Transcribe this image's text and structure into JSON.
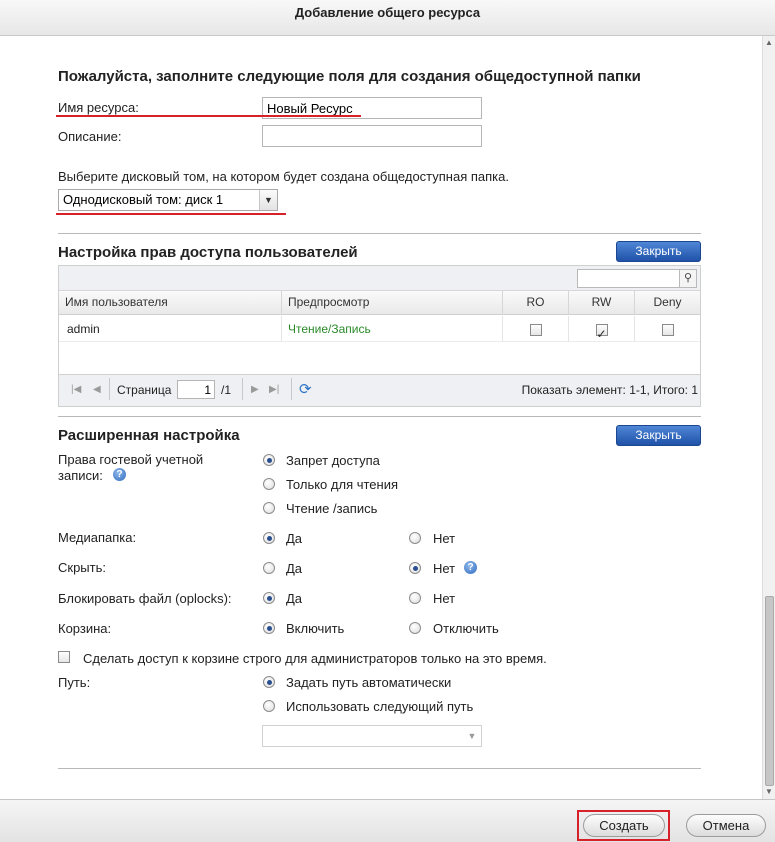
{
  "dialog": {
    "title": "Добавление общего ресурса"
  },
  "form": {
    "heading": "Пожалуйста, заполните следующие поля для создания общедоступной папки",
    "name_label": "Имя ресурса:",
    "name_value": "Новый Ресурс",
    "desc_label": "Описание:",
    "desc_value": "",
    "volume_hint": "Выберите дисковый том, на котором будет создана общедоступная папка.",
    "volume_selected": "Однодисковый том: диск  1"
  },
  "permissions": {
    "heading": "Настройка прав доступа пользователей",
    "close_label": "Закрыть",
    "search_placeholder": "",
    "columns": {
      "user": "Имя пользователя",
      "preview": "Предпросмотр",
      "ro": "RO",
      "rw": "RW",
      "deny": "Deny"
    },
    "rows": [
      {
        "user": "admin",
        "preview": "Чтение/Запись",
        "ro": false,
        "rw": true,
        "deny": false
      }
    ],
    "pager": {
      "page_label": "Страница",
      "page_value": "1",
      "total": "/1",
      "summary": "Показать элемент: 1-1, Итого: 1"
    },
    "preview_color": "#2a8a2a"
  },
  "advanced": {
    "heading": "Расширенная настройка",
    "close_label": "Закрыть",
    "guest_label": "Права гостевой учетной записи:",
    "guest_options": [
      "Запрет доступа",
      "Только для чтения",
      "Чтение /запись"
    ],
    "media_label": "Медиапапка:",
    "hide_label": "Скрыть:",
    "oplocks_label": "Блокировать файл (oplocks):",
    "recycle_label": "Корзина:",
    "yes": "Да",
    "no": "Нет",
    "enable": "Включить",
    "disable": "Отключить",
    "admin_only_label": "Сделать доступ к корзине строго для администраторов только на это время.",
    "path_label": "Путь:",
    "path_options": [
      "Задать путь автоматически",
      "Использовать следующий путь"
    ],
    "path_select_value": ""
  },
  "footer": {
    "create_label": "Создать",
    "cancel_label": "Отмена"
  },
  "colors": {
    "accent_blue": "#1f52a8",
    "highlight_red": "#d6202a"
  }
}
